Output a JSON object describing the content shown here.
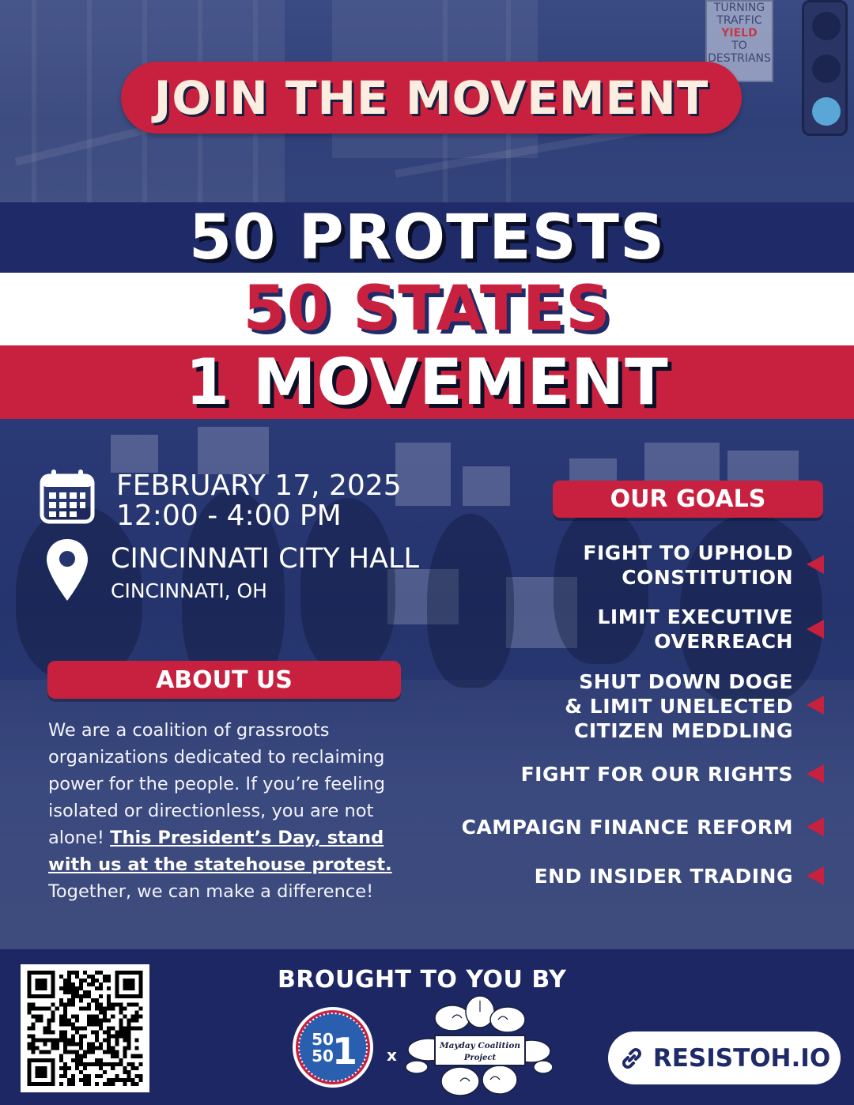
{
  "header": {
    "title": "JOIN THE MOVEMENT"
  },
  "headline": {
    "line1": "50 PROTESTS",
    "line2": "50 STATES",
    "line3": "1 MOVEMENT"
  },
  "event": {
    "date": "FEBRUARY 17, 2025",
    "time": "12:00 - 4:00 PM",
    "venue": "CINCINNATI CITY HALL",
    "city": "CINCINNATI, OH",
    "calendar_icon": "calendar-icon",
    "location_icon": "map-pin-icon"
  },
  "about": {
    "heading": "ABOUT US",
    "body_before": "We are a coalition of grassroots organizations dedicated to reclaiming power for the people. If you’re feeling isolated or directionless, you are not alone! ",
    "body_emphasis": "This President’s Day, stand with us at the statehouse protest.",
    "body_after": " Together, we can make a difference!"
  },
  "goals": {
    "heading": "OUR GOALS",
    "items": [
      {
        "lines": [
          "FIGHT TO UPHOLD",
          "CONSTITUTION"
        ]
      },
      {
        "lines": [
          "LIMIT EXECUTIVE",
          "OVERREACH"
        ]
      },
      {
        "lines": [
          "SHUT DOWN DOGE",
          "& LIMIT UNELECTED",
          "CITIZEN MEDDLING"
        ]
      },
      {
        "lines": [
          "FIGHT FOR OUR RIGHTS"
        ]
      },
      {
        "lines": [
          "CAMPAIGN FINANCE REFORM"
        ]
      },
      {
        "lines": [
          "END INSIDER TRADING"
        ]
      }
    ],
    "marker_icon": "triangle-left-icon"
  },
  "footer": {
    "brought_by": "BROUGHT TO YOU BY",
    "separator": "x",
    "logo1": {
      "top": "50",
      "bottom": "50",
      "big": "1"
    },
    "logo2": {
      "line1": "Mayday Coalition",
      "line2": "Project"
    },
    "website": "RESISTOH.IO",
    "link_icon": "link-icon",
    "qr_icon": "qr-code-icon"
  },
  "colors": {
    "navy": "#1f2a68",
    "red": "#c8213f",
    "white": "#ffffff",
    "cream": "#fbeee0"
  }
}
